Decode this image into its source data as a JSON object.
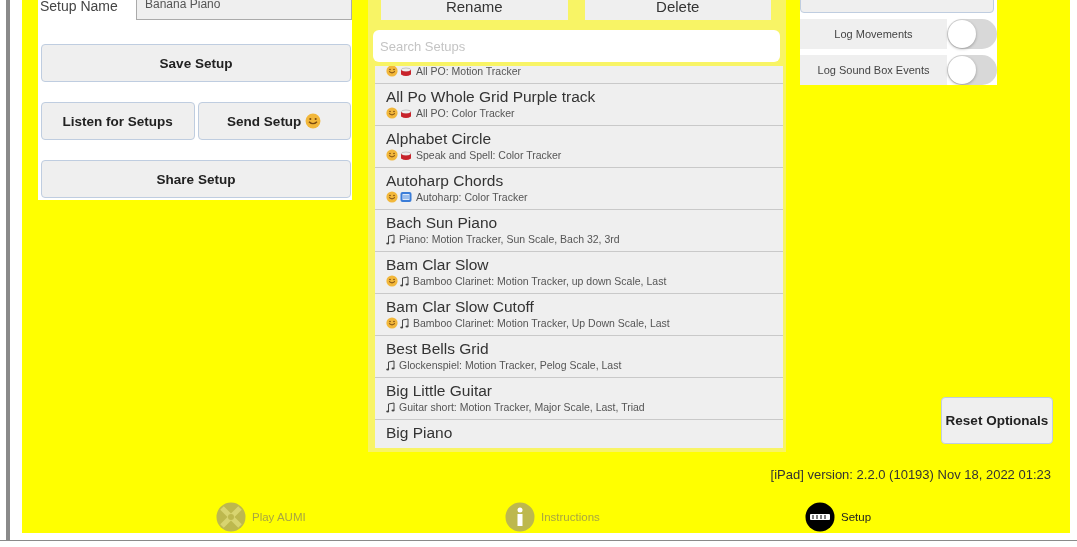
{
  "setup_panel": {
    "name_label": "Setup Name",
    "name_value": "Banana Piano",
    "buttons": [
      {
        "label": "Save Setup",
        "kind": "wide"
      },
      {
        "label": "Listen for Setups",
        "kind": "half"
      },
      {
        "label": "Send Setup",
        "kind": "half-smiley"
      },
      {
        "label": "Share Setup",
        "kind": "wide"
      }
    ]
  },
  "list_panel": {
    "actions": [
      "Rename",
      "Delete"
    ],
    "search": {
      "placeholder": "Search Setups"
    },
    "setups": [
      {
        "subtitle": "All PO: Motion Tracker",
        "kind": "smiley-drum"
      },
      {
        "title": "All Po Whole Grid Purple track",
        "subtitle": "All PO: Color Tracker",
        "kind": "smiley-drum"
      },
      {
        "title": "Alphabet Circle",
        "subtitle": "Speak and Spell: Color Tracker",
        "kind": "smiley-drum"
      },
      {
        "title": "Autoharp Chords",
        "subtitle": "Autoharp: Color Tracker",
        "kind": "smiley-harp"
      },
      {
        "title": "Bach Sun Piano",
        "subtitle": "Piano: Motion Tracker, Sun Scale, Bach 32, 3rd",
        "kind": "note"
      },
      {
        "title": "Bam Clar Slow",
        "subtitle": "Bamboo Clarinet: Motion Tracker, up down Scale, Last",
        "kind": "smiley-note"
      },
      {
        "title": "Bam Clar Slow Cutoff",
        "subtitle": "Bamboo Clarinet: Motion Tracker, Up Down Scale, Last",
        "kind": "smiley-note"
      },
      {
        "title": "Best Bells Grid",
        "subtitle": "Glockenspiel: Motion Tracker, Pelog Scale, Last",
        "kind": "note"
      },
      {
        "title": "Big Little Guitar",
        "subtitle": "Guitar short: Motion Tracker, Major Scale, Last, Triad",
        "kind": "note"
      },
      {
        "title": "Big Piano",
        "kind": "none"
      }
    ]
  },
  "log_options": [
    {
      "label": "Log Movements",
      "on": false
    },
    {
      "label": "Log Sound Box Events",
      "on": false
    }
  ],
  "reset_button": "Reset Optionals",
  "version": "[iPad] version: 2.2.0 (10193) Nov 18, 2022 01:23",
  "tab_bar": [
    {
      "label": "Play AUMI",
      "kind": "play",
      "selected": false
    },
    {
      "label": "Instructions",
      "kind": "info",
      "selected": false
    },
    {
      "label": "Setup",
      "kind": "logo",
      "selected": true
    }
  ]
}
